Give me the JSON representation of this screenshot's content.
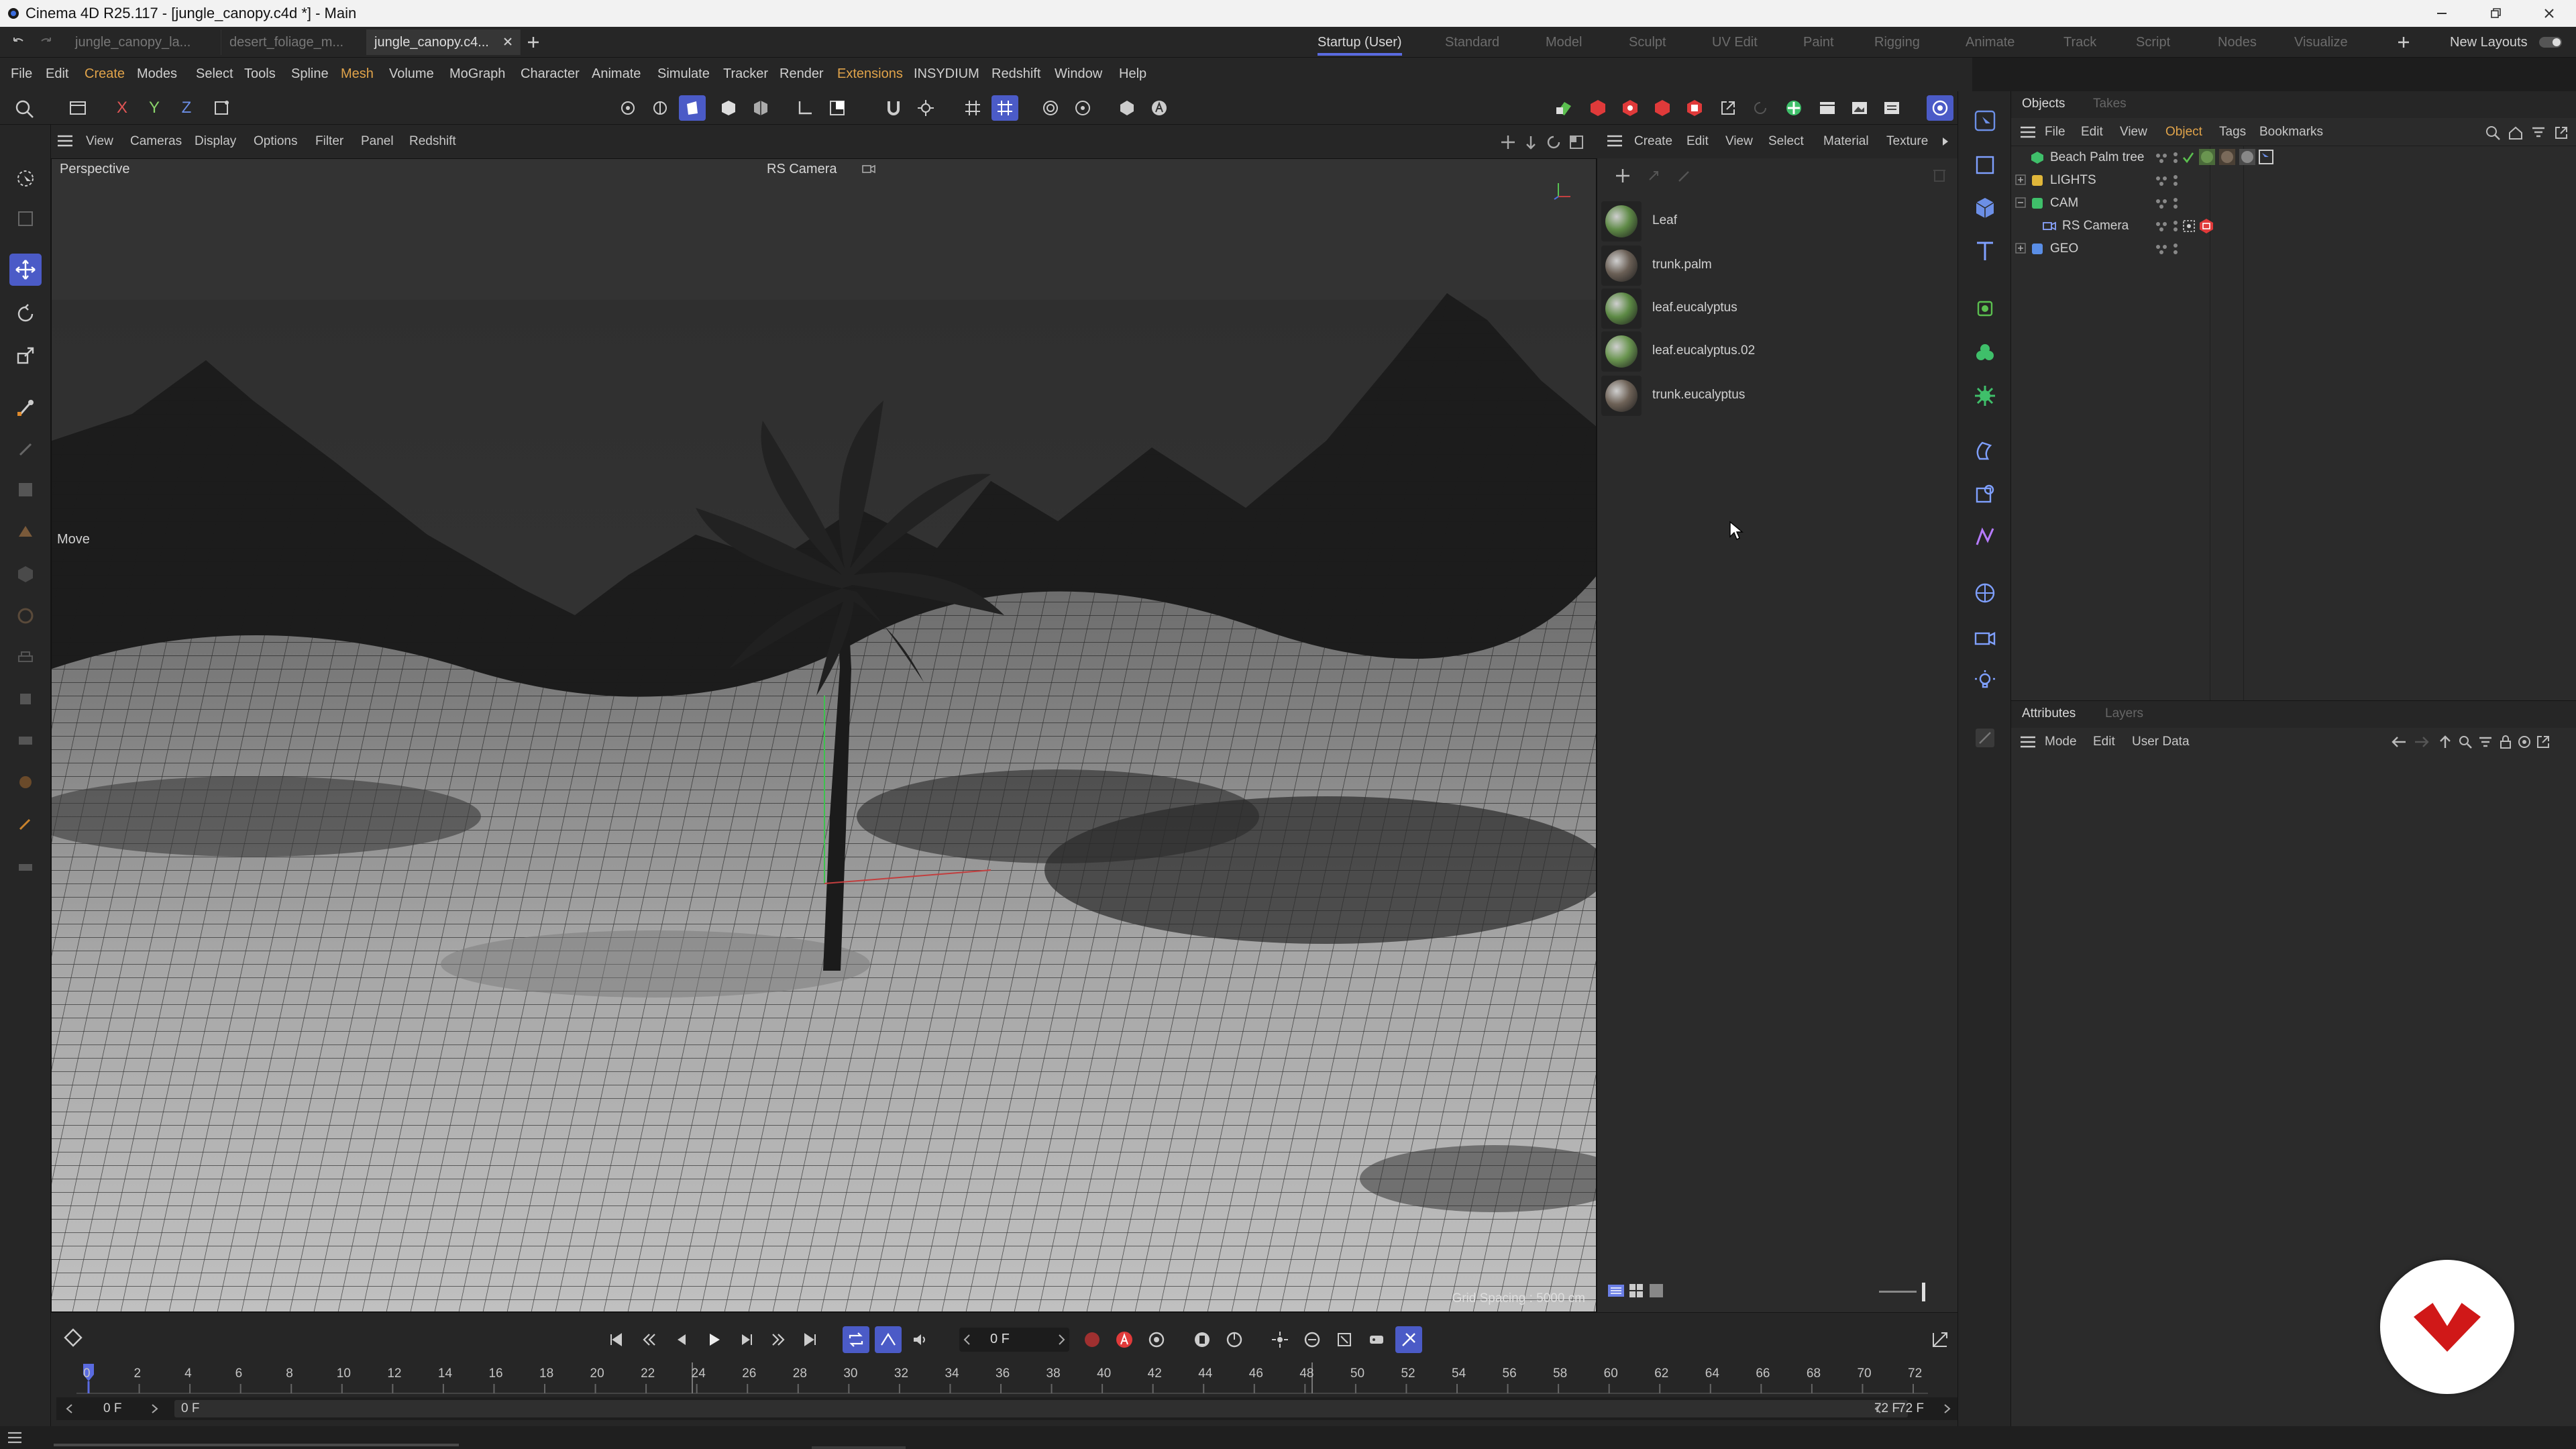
{
  "window": {
    "title": "Cinema 4D R25.117 - [jungle_canopy.c4d *] - Main"
  },
  "doc_tabs": [
    "jungle_canopy_la...",
    "desert_foliage_m...",
    "jungle_canopy.c4..."
  ],
  "layouts": [
    "Startup (User)",
    "Standard",
    "Model",
    "Sculpt",
    "UV Edit",
    "Paint",
    "Rigging",
    "Animate",
    "Track",
    "Script",
    "Nodes",
    "Visualize"
  ],
  "new_layouts_label": "New Layouts",
  "menu": [
    "File",
    "Edit",
    "Create",
    "Modes",
    "Select",
    "Tools",
    "Spline",
    "Mesh",
    "Volume",
    "MoGraph",
    "Character",
    "Animate",
    "Simulate",
    "Tracker",
    "Render",
    "Extensions",
    "INSYDIUM",
    "Redshift",
    "Window",
    "Help"
  ],
  "axis_buttons": [
    "X",
    "Y",
    "Z"
  ],
  "viewport": {
    "menu": [
      "View",
      "Cameras",
      "Display",
      "Options",
      "Filter",
      "Panel",
      "Redshift"
    ],
    "label": "Perspective",
    "camera": "RS Camera",
    "tool_hint": "Move",
    "grid_spacing": "Grid Spacing : 5000 cm"
  },
  "materials": {
    "menu": [
      "Create",
      "Edit",
      "View",
      "Select",
      "Material",
      "Texture"
    ],
    "items": [
      {
        "name": "Leaf",
        "color": "#5f8a47"
      },
      {
        "name": "trunk.palm",
        "color": "#6a5f55"
      },
      {
        "name": "leaf.eucalyptus",
        "color": "#5d8a45"
      },
      {
        "name": "leaf.eucalyptus.02",
        "color": "#6a9550"
      },
      {
        "name": "trunk.eucalyptus",
        "color": "#6e6257"
      }
    ]
  },
  "objects": {
    "tabs": [
      "Objects",
      "Takes"
    ],
    "menu": [
      "File",
      "Edit",
      "View",
      "Object",
      "Tags",
      "Bookmarks"
    ],
    "tree": [
      {
        "name": "Beach Palm tree"
      },
      {
        "name": "LIGHTS"
      },
      {
        "name": "CAM"
      },
      {
        "name": "RS Camera"
      },
      {
        "name": "GEO"
      }
    ]
  },
  "attributes": {
    "tabs": [
      "Attributes",
      "Layers"
    ],
    "menu": [
      "Mode",
      "Edit",
      "User Data"
    ]
  },
  "timeline": {
    "current_frame": "0 F",
    "ticks": [
      "0",
      "2",
      "4",
      "6",
      "8",
      "10",
      "12",
      "14",
      "16",
      "18",
      "20",
      "22",
      "24",
      "26",
      "28",
      "30",
      "32",
      "34",
      "36",
      "38",
      "40",
      "42",
      "44",
      "46",
      "48",
      "50",
      "52",
      "54",
      "56",
      "58",
      "60",
      "62",
      "64",
      "66",
      "68",
      "70",
      "72"
    ],
    "start": "0 F",
    "start2": "0 F",
    "end": "72 F",
    "end2": "72 F"
  },
  "colors": {
    "accent": "#4b5bc7",
    "record": "#e03a3a",
    "menu_highlight": "#e0a34a"
  }
}
